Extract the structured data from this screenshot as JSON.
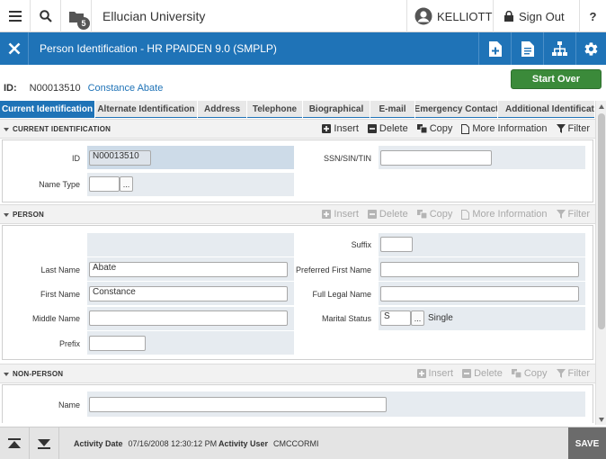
{
  "topbar": {
    "institution": "Ellucian University",
    "folder_badge": "5",
    "username": "KELLIOTT",
    "signout_label": "Sign Out",
    "help_label": "?"
  },
  "titlebar": {
    "title": "Person Identification - HR PPAIDEN 9.0 (SMPLP)"
  },
  "start_over_label": "Start Over",
  "keyblock": {
    "id_label": "ID:",
    "id_value": "N00013510",
    "name": "Constance Abate"
  },
  "tabs": [
    {
      "label": "Current Identification",
      "active": true
    },
    {
      "label": "Alternate Identification"
    },
    {
      "label": "Address"
    },
    {
      "label": "Telephone"
    },
    {
      "label": "Biographical"
    },
    {
      "label": "E-mail"
    },
    {
      "label": "Emergency Contact"
    },
    {
      "label": "Additional Identification"
    }
  ],
  "tools": {
    "insert": "Insert",
    "delete": "Delete",
    "copy": "Copy",
    "more_info": "More Information",
    "filter": "Filter"
  },
  "current_identification": {
    "title": "CURRENT IDENTIFICATION",
    "id_label": "ID",
    "id_value": "N00013510",
    "ssn_label": "SSN/SIN/TIN",
    "ssn_value": "",
    "name_type_label": "Name Type",
    "name_type_value": ""
  },
  "person": {
    "title": "PERSON",
    "last_name_label": "Last Name",
    "last_name_value": "Abate",
    "first_name_label": "First Name",
    "first_name_value": "Constance",
    "middle_name_label": "Middle Name",
    "middle_name_value": "",
    "prefix_label": "Prefix",
    "prefix_value": "",
    "suffix_label": "Suffix",
    "suffix_value": "",
    "preferred_first_label": "Preferred First Name",
    "preferred_first_value": "",
    "full_legal_label": "Full Legal Name",
    "full_legal_value": "",
    "marital_label": "Marital Status",
    "marital_value": "S",
    "marital_desc": "Single"
  },
  "non_person": {
    "title": "NON-PERSON",
    "name_label": "Name",
    "name_value": ""
  },
  "footer": {
    "activity_date_label": "Activity Date",
    "activity_date_value": "07/16/2008 12:30:12 PM",
    "activity_user_label": "Activity User",
    "activity_user_value": "CMCCORMI",
    "save_label": "SAVE"
  }
}
